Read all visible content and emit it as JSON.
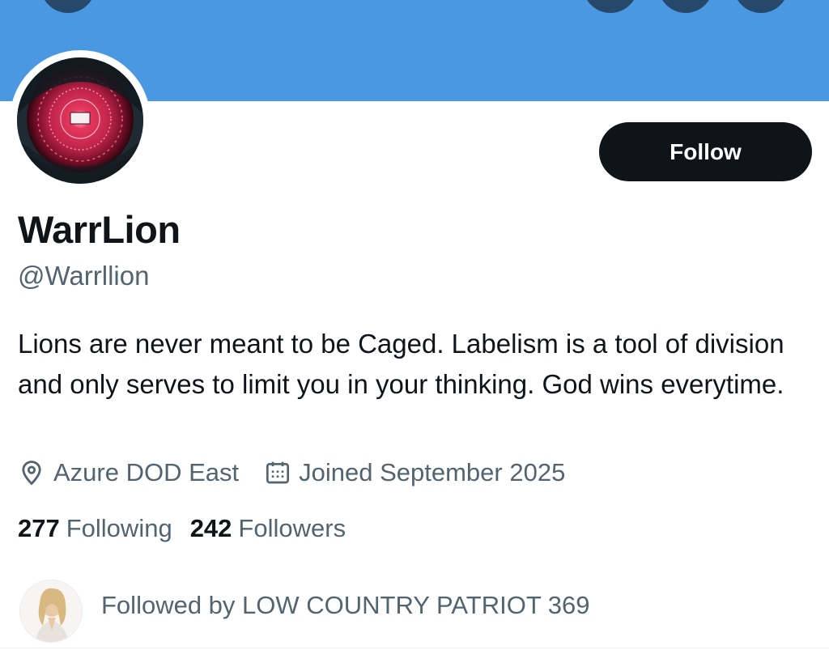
{
  "profile": {
    "display_name": "WarrLion",
    "handle": "@Warrllion",
    "bio": "Lions are never meant to be Caged. Labelism is a tool of division and only serves to limit you in your thinking. God wins everytime.",
    "location": "Azure DOD East",
    "joined": "Joined September 2025",
    "avatar": "red-eye-avatar"
  },
  "actions": {
    "follow_label": "Follow"
  },
  "stats": {
    "following_count": "277",
    "following_label": "Following",
    "followers_count": "242",
    "followers_label": "Followers"
  },
  "followed_by": {
    "text": "Followed by LOW COUNTRY PATRIOT 369",
    "avatar": "follower-avatar"
  },
  "icons": {
    "location": "location-pin-icon",
    "joined": "calendar-icon"
  },
  "colors": {
    "banner": "#4a98e2",
    "nav_buttons": "#26486b",
    "follow_button": "#0f1419",
    "secondary_text": "#536471",
    "primary_text": "#0f1419"
  }
}
